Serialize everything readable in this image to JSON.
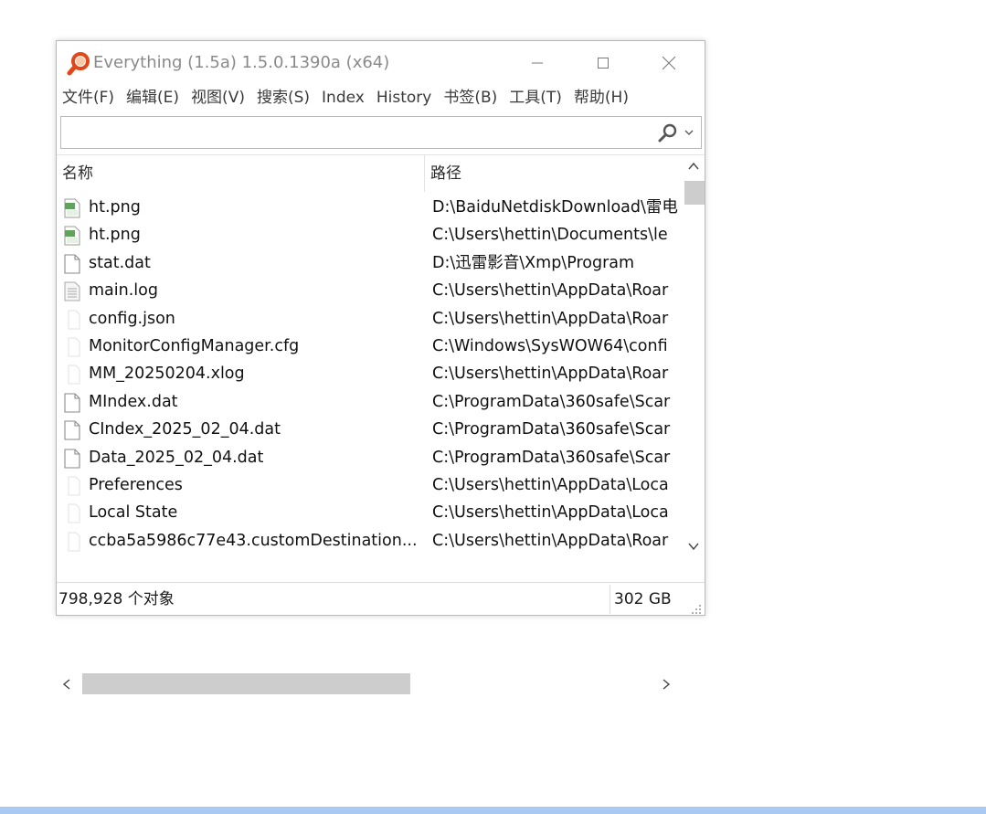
{
  "window": {
    "title": "Everything (1.5a) 1.5.0.1390a (x64)",
    "icon": "magnifier-app-icon"
  },
  "menu": [
    {
      "label": "文件(F)"
    },
    {
      "label": "编辑(E)"
    },
    {
      "label": "视图(V)"
    },
    {
      "label": "搜索(S)"
    },
    {
      "label": "Index"
    },
    {
      "label": "History"
    },
    {
      "label": "书签(B)"
    },
    {
      "label": "工具(T)"
    },
    {
      "label": "帮助(H)"
    }
  ],
  "search": {
    "value": "",
    "placeholder": ""
  },
  "columns": {
    "name": "名称",
    "path": "路径"
  },
  "rows": [
    {
      "name": "ht.png",
      "path": "D:\\BaiduNetdiskDownload\\雷电",
      "icon": "png-file-icon"
    },
    {
      "name": "ht.png",
      "path": "C:\\Users\\hettin\\Documents\\le",
      "icon": "png-file-icon"
    },
    {
      "name": "stat.dat",
      "path": "D:\\迅雷影音\\Xmp\\Program",
      "icon": "file-icon"
    },
    {
      "name": "main.log",
      "path": "C:\\Users\\hettin\\AppData\\Roar",
      "icon": "text-file-icon"
    },
    {
      "name": "config.json",
      "path": "C:\\Users\\hettin\\AppData\\Roar",
      "icon": "blank-file-icon"
    },
    {
      "name": "MonitorConfigManager.cfg",
      "path": "C:\\Windows\\SysWOW64\\confi",
      "icon": "blank-file-icon"
    },
    {
      "name": "MM_20250204.xlog",
      "path": "C:\\Users\\hettin\\AppData\\Roar",
      "icon": "blank-file-icon"
    },
    {
      "name": "MIndex.dat",
      "path": "C:\\ProgramData\\360safe\\Scar",
      "icon": "file-icon"
    },
    {
      "name": "CIndex_2025_02_04.dat",
      "path": "C:\\ProgramData\\360safe\\Scar",
      "icon": "file-icon"
    },
    {
      "name": "Data_2025_02_04.dat",
      "path": "C:\\ProgramData\\360safe\\Scar",
      "icon": "file-icon"
    },
    {
      "name": "Preferences",
      "path": "C:\\Users\\hettin\\AppData\\Loca",
      "icon": "blank-file-icon"
    },
    {
      "name": "Local State",
      "path": "C:\\Users\\hettin\\AppData\\Loca",
      "icon": "blank-file-icon"
    },
    {
      "name": "ccba5a5986c77e43.customDestination...",
      "path": "C:\\Users\\hettin\\AppData\\Roar",
      "icon": "blank-file-icon"
    }
  ],
  "status": {
    "count": "798,928 个对象",
    "size": "302 GB"
  },
  "colors": {
    "accent": "#e0471b",
    "taskbar": "#a9c9f5",
    "scroll_thumb": "#cdcdcd"
  }
}
